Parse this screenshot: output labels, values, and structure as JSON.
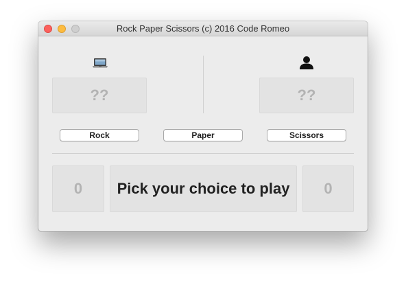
{
  "window": {
    "title": "Rock Paper Scissors (c) 2016 Code Romeo"
  },
  "players": {
    "computer": {
      "icon": "laptop-icon",
      "choice": "??"
    },
    "human": {
      "icon": "user-icon",
      "choice": "??"
    }
  },
  "buttons": {
    "rock": "Rock",
    "paper": "Paper",
    "scissors": "Scissors"
  },
  "scoreboard": {
    "computer_score": "0",
    "human_score": "0",
    "message": "Pick your choice to play"
  }
}
